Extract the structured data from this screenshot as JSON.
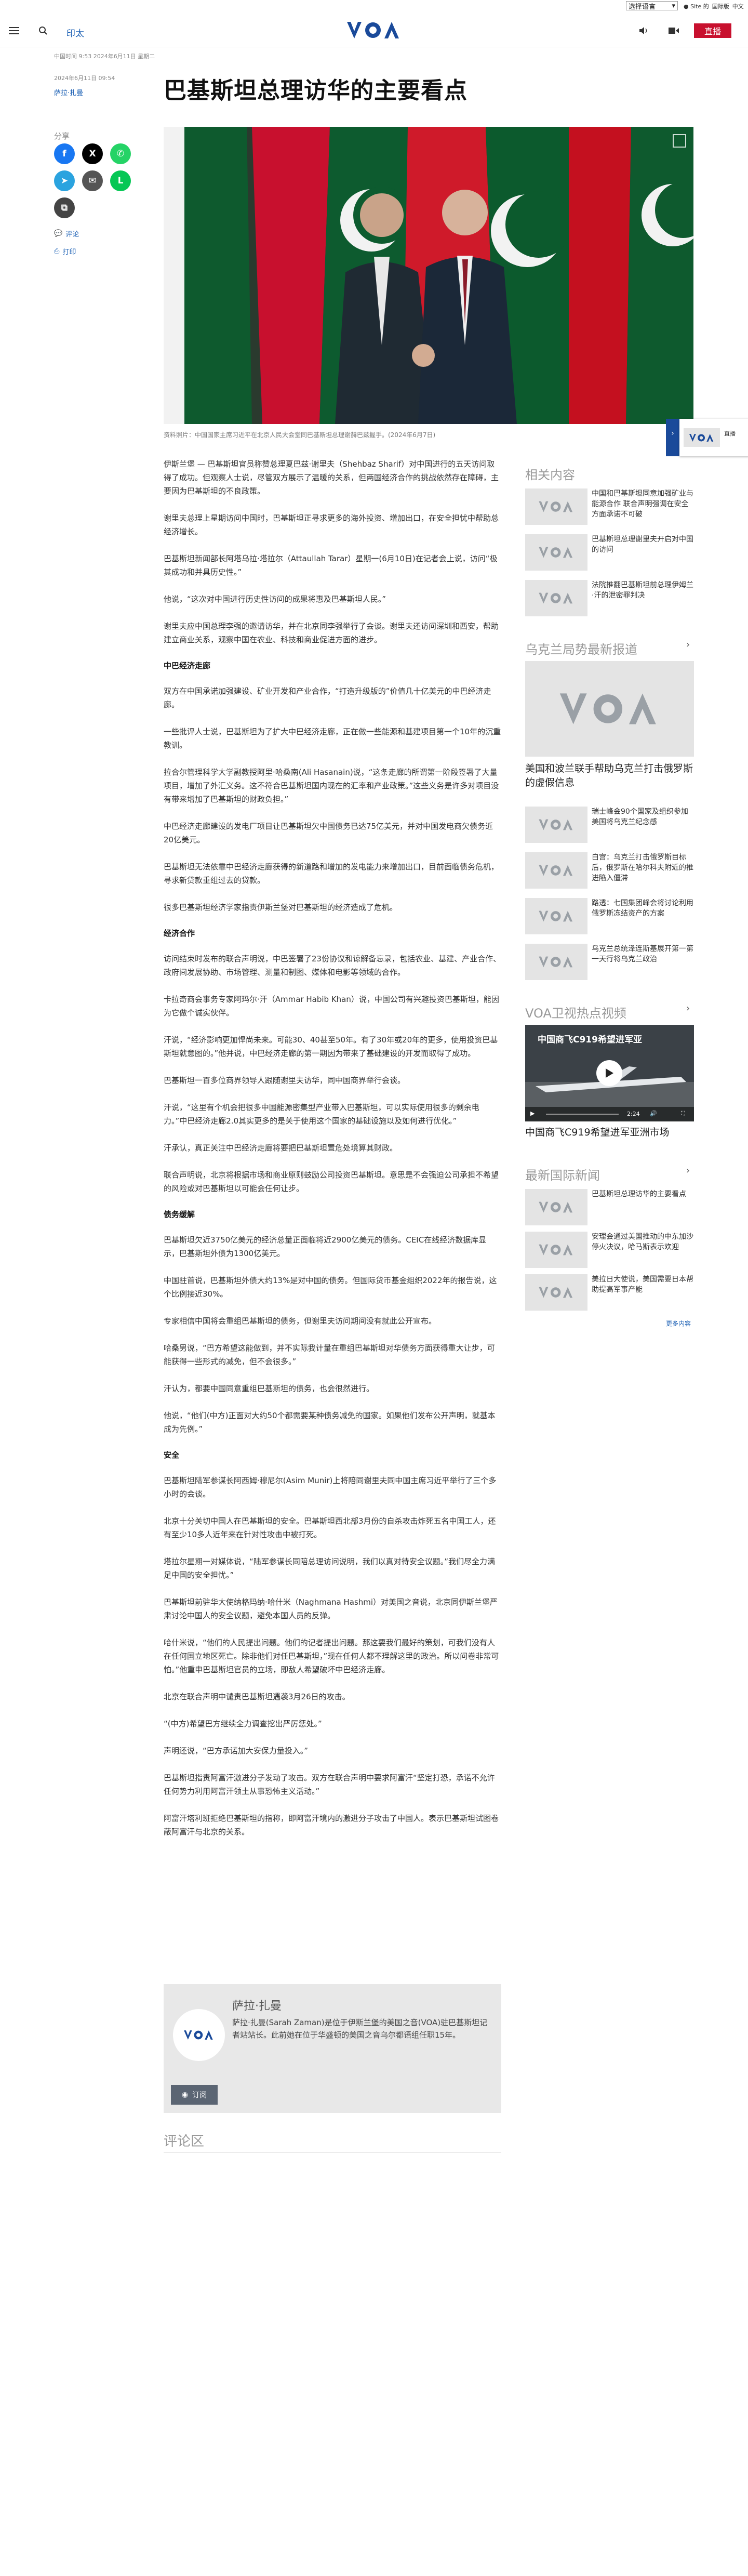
{
  "topbar": {
    "language": "选择语言",
    "links": [
      "● Site 的",
      "国际版",
      "中文"
    ]
  },
  "header": {
    "section": "印太",
    "live": "直播"
  },
  "article": {
    "published": "中国时间 9:53 2024年6月11日 星期二",
    "updated": "2024年6月11日 09:54",
    "author": "萨拉·扎曼",
    "title": "巴基斯坦总理访华的主要看点",
    "caption": "资料照片：中国国家主席习近平在北京人民大会堂同巴基斯坦总理谢赫巴兹握手。(2024年6月7日)",
    "blocks": [
      {
        "type": "p",
        "text": "伊斯兰堡 — 巴基斯坦官员称赞总理夏巴兹·谢里夫（Shehbaz Sharif）对中国进行的五天访问取得了成功。但观察人士说，尽管双方展示了温暖的关系，但两国经济合作的挑战依然存在障碍，主要因为巴基斯坦的不良政策。"
      },
      {
        "type": "p",
        "text": "谢里夫总理上星期访问中国时，巴基斯坦正寻求更多的海外投资、增加出口，在安全担忧中帮助总经济增长。"
      },
      {
        "type": "p",
        "text": "巴基斯坦新闻部长阿塔乌拉·塔拉尔（Attaullah Tarar）星期一(6月10日)在记者会上说，访问“极其成功和并具历史性。”"
      },
      {
        "type": "p",
        "text": "他说，“这次对中国进行历史性访问的成果将惠及巴基斯坦人民。”"
      },
      {
        "type": "p",
        "text": "谢里夫应中国总理李强的邀请访华，并在北京同李强举行了会谈。谢里夫还访问深圳和西安，帮助建立商业关系，观察中国在农业、科技和商业促进方面的进步。"
      },
      {
        "type": "h",
        "text": "中巴经济走廊"
      },
      {
        "type": "p",
        "text": "双方在中国承诺加强建设、矿业开发和产业合作，“打造升级版的”价值几十亿美元的中巴经济走廊。"
      },
      {
        "type": "p",
        "text": "一些批评人士说，巴基斯坦为了扩大中巴经济走廊，正在做一些能源和基建项目第一个10年的沉重教训。"
      },
      {
        "type": "p",
        "text": "拉合尔管理科学大学副教授阿里·哈桑南(Ali Hasanain)说，“这条走廊的所谓第一阶段签署了大量项目，增加了外汇义务。这不符合巴基斯坦国内现在的汇率和产业政策。”这些义务是许多对项目没有带来增加了巴基斯坦的财政负担。”"
      },
      {
        "type": "p",
        "text": "中巴经济走廊建设的发电厂项目让巴基斯坦欠中国债务已达75亿美元，并对中国发电商欠债务近20亿美元。"
      },
      {
        "type": "p",
        "text": "巴基斯坦无法依靠中巴经济走廊获得的新道路和增加的发电能力来增加出口，目前面临债务危机，寻求新贷款重组过去的贷款。"
      },
      {
        "type": "p",
        "text": "很多巴基斯坦经济学家指责伊斯兰堡对巴基斯坦的经济造成了危机。"
      },
      {
        "type": "h",
        "text": "经济合作"
      },
      {
        "type": "p",
        "text": "访问结束时发布的联合声明说，中巴签署了23份协议和谅解备忘录，包括农业、基建、产业合作、政府间发展协助、市场管理、测量和制图、媒体和电影等领域的合作。"
      },
      {
        "type": "p",
        "text": "卡拉奇商会事务专家阿玛尔·汗（Ammar Habib Khan）说，中国公司有兴趣投资巴基斯坦，能因为它做个诚实伙伴。"
      },
      {
        "type": "p",
        "text": "汗说，“经济影响更加悍尚未来。可能30、40甚至50年。有了30年或20年的更多，使用投资巴基斯坦就意图的。”他并说，中巴经济走廊的第一期因为带来了基础建设的开发而取得了成功。"
      },
      {
        "type": "p",
        "text": "巴基斯坦一百多位商界领导人跟随谢里夫访华，同中国商界举行会谈。"
      },
      {
        "type": "p",
        "text": "汗说，“这里有个机会把很多中国能源密集型产业带入巴基斯坦，可以实际使用很多的剩余电力。”中巴经济走廊2.0其实更多的是关于使用这个国家的基础设施以及如何进行优化。”"
      },
      {
        "type": "p",
        "text": "汗承认，真正关注中巴经济走廊将要把巴基斯坦置危处境算其财政。"
      },
      {
        "type": "p",
        "text": "联合声明说，北京将根据市场和商业原则鼓励公司投资巴基斯坦。意思是不会强迫公司承担不希望的风险或对巴基斯坦以可能会任何让步。"
      },
      {
        "type": "h",
        "text": "债务缓解"
      },
      {
        "type": "p",
        "text": "巴基斯坦欠近3750亿美元的经济总量正面临将近2900亿美元的债务。CEIC在线经济数据库显示，巴基斯坦外债为1300亿美元。"
      },
      {
        "type": "p",
        "text": "中国驻首说，巴基斯坦外债大约13%是对中国的债务。但国际货币基金组织2022年的报告说，这个比例接近30%。"
      },
      {
        "type": "p",
        "text": "专家相信中国将会重组巴基斯坦的债务，但谢里夫访问期间没有就此公开宣布。"
      },
      {
        "type": "p",
        "text": "哈桑男说，“巴方希望这能做到，并不实际我计量在重组巴基斯坦对华债务方面获得重大让步，可能获得一些形式的减免，但不会很多。”"
      },
      {
        "type": "p",
        "text": "汗认为，都要中国同意重组巴基斯坦的债务，也会很然进行。"
      },
      {
        "type": "p",
        "text": "他说，“他们(中方)正面对大约50个都需要某种债务减免的国家。如果他们发布公开声明，就基本成为先例。”"
      },
      {
        "type": "h",
        "text": "安全"
      },
      {
        "type": "p",
        "text": "巴基斯坦陆军参谋长阿西姆·穆尼尔(Asim Munir)上将陪同谢里夫同中国主席习近平举行了三个多小时的会谈。"
      },
      {
        "type": "p",
        "text": "北京十分关切中国人在巴基斯坦的安全。巴基斯坦西北部3月份的自杀攻击炸死五名中国工人，还有至少10多人近年来在针对性攻击中被打死。"
      },
      {
        "type": "p",
        "text": "塔拉尔星期一对媒体说，“陆军参谋长同陪总理访问说明，我们以真对待安全议题。”我们尽全力满足中国的安全担忧。”"
      },
      {
        "type": "p",
        "text": "巴基斯坦前驻华大使纳格玛纳·哈什米（Naghmana Hashmi）对美国之音说，北京同伊斯兰堡严肃讨论中国人的安全议题，避免本国人员的反弹。"
      },
      {
        "type": "p",
        "text": "哈什米说，“他们的人民提出问题。他们的记者提出问题。那这要我们最好的策划，可我们没有人在任何国立地区死亡。除非他们对任巴基斯坦，”现在任何人都不理解这里的政治。所以问卷非常可怕。”他重申巴基斯坦官员的立场，即敌人希望破坏中巴经济走廊。"
      },
      {
        "type": "p",
        "text": "北京在联合声明中谴责巴基斯坦遇袭3月26日的攻击。"
      },
      {
        "type": "p",
        "text": "“(中方)希望巴方继续全力调查挖出严厉惩处。”"
      },
      {
        "type": "p",
        "text": "声明还说，“巴方承诺加大安保力量投入。”"
      },
      {
        "type": "p",
        "text": "巴基斯坦指责阿富汗激进分子发动了攻击。双方在联合声明中要求阿富汗“坚定打恐，承诺不允许任何势力利用阿富汗领土从事恐怖主义活动。”"
      },
      {
        "type": "p",
        "text": "阿富汗塔利班拒绝巴基斯坦的指称，即阿富汗境内的激进分子攻击了中国人。表示巴基斯坦试图卷蔽阿富汗与北京的关系。"
      }
    ]
  },
  "share": {
    "label": "分享",
    "comments": "评论",
    "print": "打印"
  },
  "author_box": {
    "name": "萨拉·扎曼",
    "bio": "萨拉·扎曼(Sarah Zaman)是位于伊斯兰堡的美国之音(VOA)驻巴基斯坦记者站站长。此前她在位于华盛顿的美国之音乌尔都语组任职15年。",
    "subscribe": "订阅"
  },
  "comments": {
    "heading": "评论区"
  },
  "sidebar": {
    "related_heading": "相关内容",
    "related": [
      {
        "text": "中国和巴基斯坦同意加强矿业与能源合作 联合声明强调在安全方面承诺不可破"
      },
      {
        "text": "巴基斯坦总理谢里夫开启对中国的访问"
      },
      {
        "text": "法院推翻巴基斯坦前总理伊姆兰·汗的泄密罪判决"
      }
    ],
    "ukraine_heading": "乌克兰局势最新报道",
    "ukraine_feature": "美国和波兰联手帮助乌克兰打击俄罗斯的虚假信息",
    "ukraine": [
      {
        "text": "瑞士峰会90个国家及组织参加 美国将乌克兰纪念感"
      },
      {
        "text": "白宫：乌克兰打击俄罗斯目标后，俄罗斯在哈尔科夫附近的推进陷入僵滞"
      },
      {
        "text": "路透：七国集团峰会将讨论利用俄罗斯冻结资产的方案"
      },
      {
        "text": "乌克兰总统泽连斯基展开第一第一天行将乌克兰政治"
      }
    ],
    "video_heading": "VOA卫视热点视频",
    "video_overlay": "中国商飞C919希望进军亚",
    "video_time": "2:24",
    "video_title": "中国商飞C919希望进军亚洲市场",
    "intl_heading": "最新国际新闻",
    "intl": [
      {
        "text": "巴基斯坦总理访华的主要看点"
      },
      {
        "text": "安理会通过美国推动的中东加沙停火决议，哈马斯表示欢迎"
      },
      {
        "text": "美拉日大使说，美国需要日本帮助提高军事产能"
      }
    ],
    "more": "更多内容"
  },
  "float_widget": {
    "text": "直播"
  }
}
